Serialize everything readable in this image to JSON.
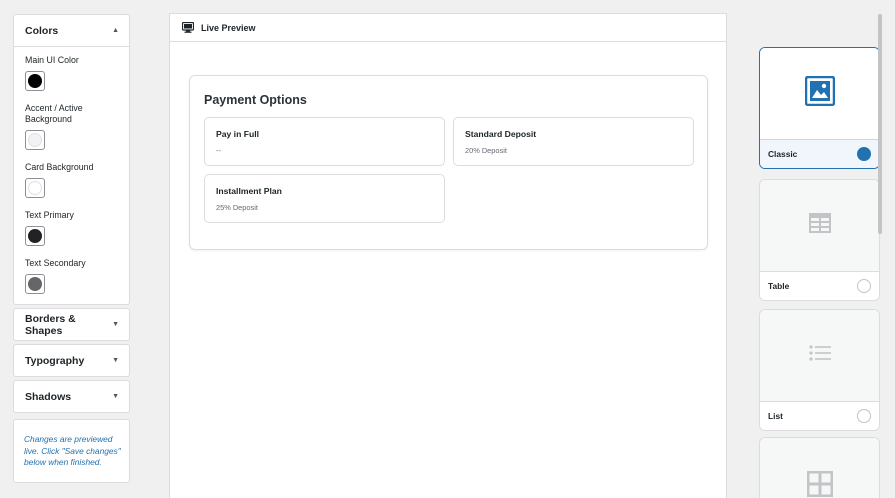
{
  "sidebar": {
    "colors": {
      "title": "Colors",
      "fields": [
        {
          "label": "Main UI Color",
          "color": "#000000"
        },
        {
          "label": "Accent / Active Background",
          "color": "#f2f2f2"
        },
        {
          "label": "Card Background",
          "color": "#ffffff"
        },
        {
          "label": "Text Primary",
          "color": "#222222"
        },
        {
          "label": "Text Secondary",
          "color": "#666666"
        }
      ]
    },
    "sections": [
      {
        "title": "Borders & Shapes"
      },
      {
        "title": "Typography"
      },
      {
        "title": "Shadows"
      }
    ],
    "note": "Changes are previewed live. Click \"Save changes\" below when finished."
  },
  "preview": {
    "title": "Live Preview",
    "card_title": "Payment Options",
    "options": [
      {
        "title": "Pay in Full",
        "sub": "--"
      },
      {
        "title": "Standard Deposit",
        "sub": "20% Deposit"
      },
      {
        "title": "Installment Plan",
        "sub": "25% Deposit"
      }
    ]
  },
  "layouts": [
    {
      "label": "Classic",
      "selected": true,
      "icon": "image-icon"
    },
    {
      "label": "Table",
      "selected": false,
      "icon": "table-icon"
    },
    {
      "label": "List",
      "selected": false,
      "icon": "list-icon"
    },
    {
      "label": "",
      "selected": false,
      "icon": "grid-icon"
    }
  ],
  "colors": {
    "accent": "#2271b1",
    "border": "#dcdcde"
  }
}
